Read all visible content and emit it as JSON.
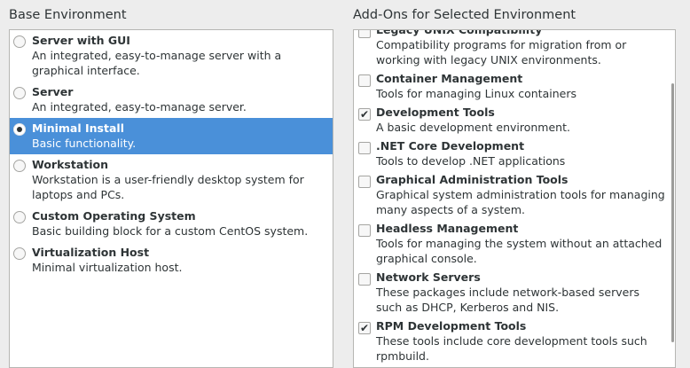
{
  "base_environment": {
    "heading": "Base Environment",
    "items": [
      {
        "title": "Server with GUI",
        "desc": "An integrated, easy-to-manage server with a graphical interface.",
        "selected": false
      },
      {
        "title": "Server",
        "desc": "An integrated, easy-to-manage server.",
        "selected": false
      },
      {
        "title": "Minimal Install",
        "desc": "Basic functionality.",
        "selected": true
      },
      {
        "title": "Workstation",
        "desc": "Workstation is a user-friendly desktop system for laptops and PCs.",
        "selected": false
      },
      {
        "title": "Custom Operating System",
        "desc": "Basic building block for a custom CentOS system.",
        "selected": false
      },
      {
        "title": "Virtualization Host",
        "desc": "Minimal virtualization host.",
        "selected": false
      }
    ]
  },
  "addons": {
    "heading": "Add-Ons for Selected Environment",
    "items": [
      {
        "title": "Legacy UNIX Compatibility",
        "desc": "Compatibility programs for migration from or working with legacy UNIX environments.",
        "checked": false
      },
      {
        "title": "Container Management",
        "desc": "Tools for managing Linux containers",
        "checked": false
      },
      {
        "title": "Development Tools",
        "desc": "A basic development environment.",
        "checked": true
      },
      {
        "title": ".NET Core Development",
        "desc": "Tools to develop .NET applications",
        "checked": false
      },
      {
        "title": "Graphical Administration Tools",
        "desc": "Graphical system administration tools for managing many aspects of a system.",
        "checked": false
      },
      {
        "title": "Headless Management",
        "desc": "Tools for managing the system without an attached graphical console.",
        "checked": false
      },
      {
        "title": "Network Servers",
        "desc": "These packages include network-based servers such as DHCP, Kerberos and NIS.",
        "checked": false
      },
      {
        "title": "RPM Development Tools",
        "desc": "These tools include core development tools such rpmbuild.",
        "checked": true
      }
    ]
  },
  "colors": {
    "selection": "#4a90d9",
    "background": "#ededed"
  }
}
